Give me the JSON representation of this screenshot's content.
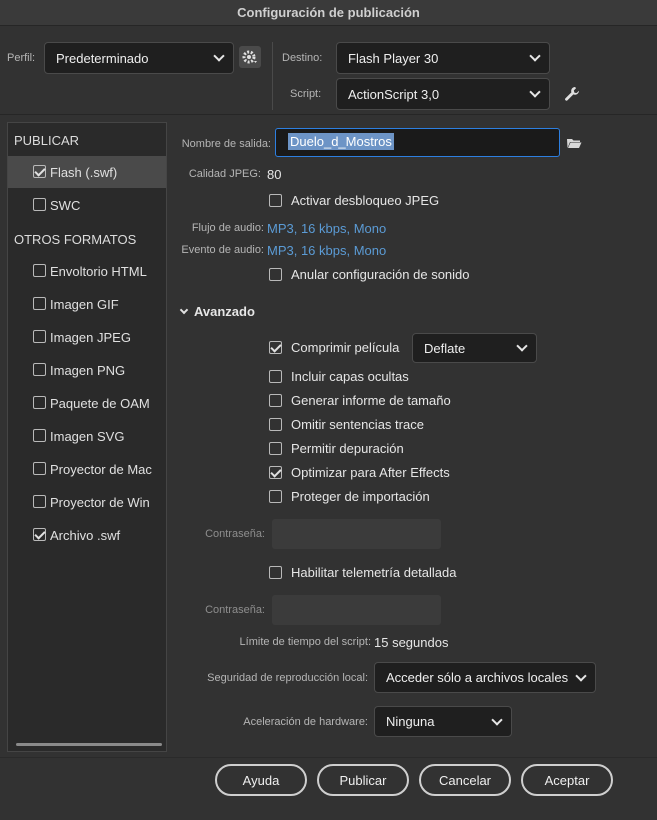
{
  "window": {
    "title": "Configuración de publicación"
  },
  "header": {
    "perfil_label": "Perfil:",
    "perfil_value": "Predeterminado",
    "destino_label": "Destino:",
    "destino_value": "Flash Player 30",
    "script_label": "Script:",
    "script_value": "ActionScript 3,0"
  },
  "sidebar": {
    "section_publicar": "PUBLICAR",
    "section_otros": "OTROS FORMATOS",
    "items": [
      {
        "label": "Flash (.swf)",
        "checked": true
      },
      {
        "label": "SWC",
        "checked": false
      },
      {
        "label": "Envoltorio HTML",
        "checked": false
      },
      {
        "label": "Imagen GIF",
        "checked": false
      },
      {
        "label": "Imagen JPEG",
        "checked": false
      },
      {
        "label": "Imagen PNG",
        "checked": false
      },
      {
        "label": "Paquete de OAM",
        "checked": false
      },
      {
        "label": "Imagen SVG",
        "checked": false
      },
      {
        "label": "Proyector de Mac",
        "checked": false
      },
      {
        "label": "Proyector de Win",
        "checked": false
      },
      {
        "label": "Archivo .swf",
        "checked": true
      }
    ]
  },
  "main": {
    "output_label": "Nombre de salida:",
    "output_value": "Duelo_d_Mostros",
    "jpeg_quality_label": "Calidad JPEG:",
    "jpeg_quality_value": "80",
    "jpeg_unlock_label": "Activar desbloqueo JPEG",
    "audio_stream_label": "Flujo de audio:",
    "audio_stream_value": "MP3, 16 kbps, Mono",
    "audio_event_label": "Evento de audio:",
    "audio_event_value": "MP3, 16 kbps, Mono",
    "override_sound_label": "Anular configuración de sonido",
    "advanced_label": "Avanzado",
    "compress_label": "Comprimir película",
    "compress_value": "Deflate",
    "hidden_layers_label": "Incluir capas ocultas",
    "size_report_label": "Generar informe de tamaño",
    "omit_trace_label": "Omitir sentencias trace",
    "debug_label": "Permitir depuración",
    "after_effects_label": "Optimizar para After Effects",
    "protect_import_label": "Proteger de importación",
    "password_label": "Contraseña:",
    "telemetry_label": "Habilitar telemetría detallada",
    "password2_label": "Contraseña:",
    "script_limit_label": "Límite de tiempo del script:",
    "script_limit_value": "15 segundos",
    "local_security_label": "Seguridad de reproducción local:",
    "local_security_value": "Acceder sólo a archivos locales",
    "hw_accel_label": "Aceleración de hardware:",
    "hw_accel_value": "Ninguna"
  },
  "footer": {
    "help": "Ayuda",
    "publish": "Publicar",
    "cancel": "Cancelar",
    "accept": "Aceptar"
  }
}
